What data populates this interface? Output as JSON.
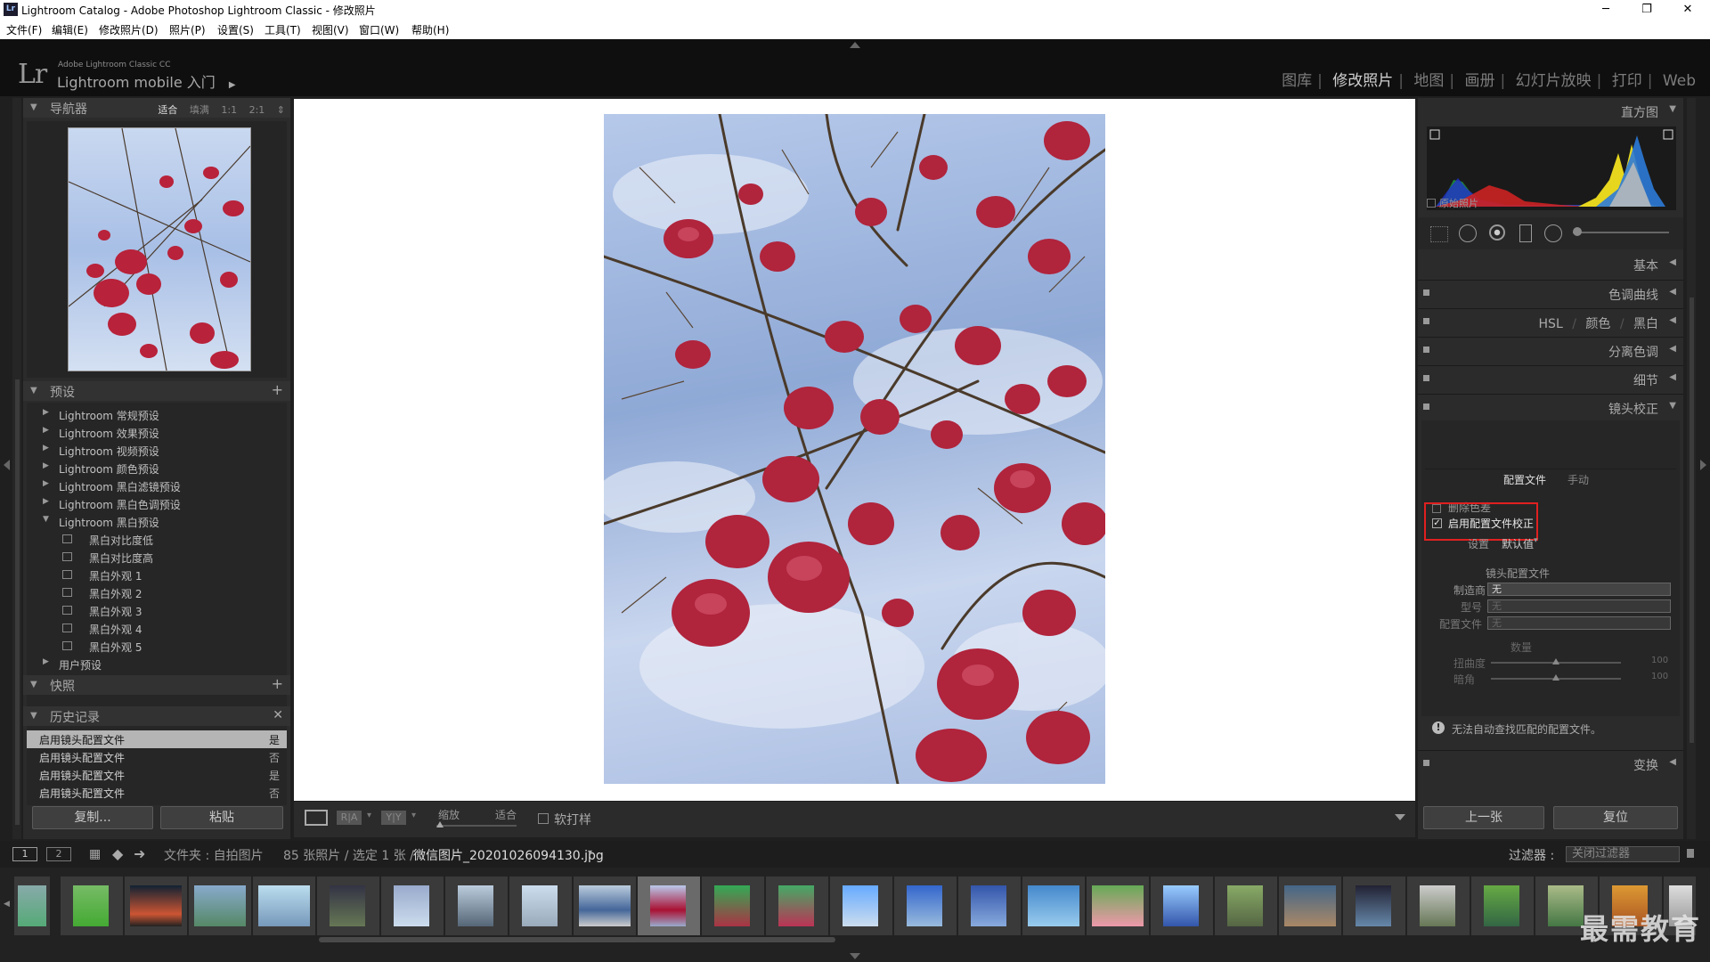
{
  "window": {
    "title": "Lightroom Catalog - Adobe Photoshop Lightroom Classic - 修改照片",
    "logo": "Lr",
    "min_icon": "minimize-icon",
    "max_icon": "maximize-icon",
    "close_icon": "close-icon",
    "min_glyph": "─",
    "max_glyph": "❐",
    "close_glyph": "✕"
  },
  "menu": [
    "文件(F)",
    "编辑(E)",
    "修改照片(D)",
    "照片(P)",
    "设置(S)",
    "工具(T)",
    "视图(V)",
    "窗口(W)",
    "帮助(H)"
  ],
  "identity": {
    "logo": "Lr",
    "small": "Adobe Lightroom Classic CC",
    "big": "Lightroom mobile 入门",
    "arrow": "▶"
  },
  "modules": [
    "图库",
    "修改照片",
    "地图",
    "画册",
    "幻灯片放映",
    "打印",
    "Web"
  ],
  "active_module": "修改照片",
  "left": {
    "navigator": {
      "title": "导航器",
      "opts": [
        "适合",
        "填满",
        "1:1",
        "2:1"
      ]
    },
    "presets": {
      "title": "预设",
      "groups": [
        "Lightroom 常规预设",
        "Lightroom 效果预设",
        "Lightroom 视频预设",
        "Lightroom 颜色预设",
        "Lightroom 黑白滤镜预设",
        "Lightroom 黑白色调预设",
        "Lightroom 黑白预设"
      ],
      "bw_items": [
        "黑白对比度低",
        "黑白对比度高",
        "黑白外观 1",
        "黑白外观 2",
        "黑白外观 3",
        "黑白外观 4",
        "黑白外观 5"
      ],
      "user": "用户预设"
    },
    "snapshots": {
      "title": "快照"
    },
    "history": {
      "title": "历史记录",
      "items": [
        {
          "label": "启用镜头配置文件",
          "value": "是"
        },
        {
          "label": "启用镜头配置文件",
          "value": "否"
        },
        {
          "label": "启用镜头配置文件",
          "value": "是"
        },
        {
          "label": "启用镜头配置文件",
          "value": "否"
        }
      ]
    },
    "copy": "复制...",
    "paste": "粘贴"
  },
  "toolbar": {
    "zoom_label": "缩放",
    "zoom_value": "适合",
    "softproof": "软打样"
  },
  "right": {
    "histogram": {
      "title": "直方图",
      "original": "原始照片"
    },
    "panels": [
      "基本",
      "色调曲线",
      "分离色调",
      "细节",
      "镜头校正",
      "变换"
    ],
    "hsl": {
      "a": "HSL",
      "b": "颜色",
      "c": "黑白"
    },
    "lens": {
      "tab_profile": "配置文件",
      "tab_manual": "手动",
      "remove_ca": "删除色差",
      "enable_profile": "启用配置文件校正",
      "setup_label": "设置",
      "setup_value": "默认值",
      "profile_heading": "镜头配置文件",
      "make_label": "制造商",
      "make_value": "无",
      "model_label": "型号",
      "model_value": "无",
      "profile_label": "配置文件",
      "profile_value": "无",
      "amount_heading": "数量",
      "distortion_label": "扭曲度",
      "distortion_value": "100",
      "vignette_label": "暗角",
      "vignette_value": "100",
      "warning": "无法自动查找匹配的配置文件。"
    },
    "prev": "上一张",
    "reset": "复位"
  },
  "filmbar": {
    "page1": "1",
    "page2": "2",
    "folder": "文件夹 : 自拍图片",
    "count": "85 张照片 / 选定 1 张 /",
    "filename": "微信图片_20201026094130.jpg",
    "filter_label": "过滤器 :",
    "filter_value": "关闭过滤器"
  },
  "watermark": "最需教育",
  "colors": {
    "highlight_box": "#e02020",
    "bg": "#1f1f1f",
    "panel": "#2b2b2b"
  }
}
